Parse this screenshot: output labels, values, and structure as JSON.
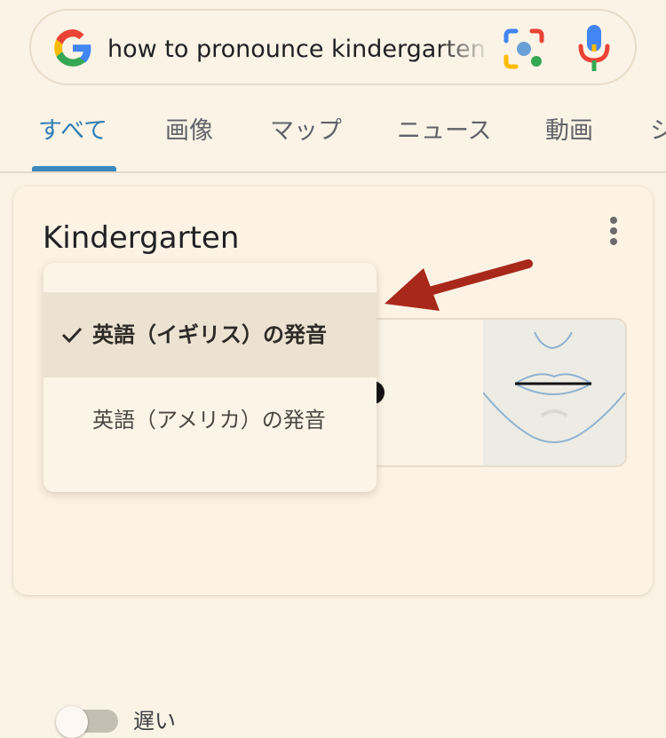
{
  "search": {
    "query": "how to pronounce kindergarten",
    "logo_icon": "google-g-icon",
    "lens_icon": "lens-icon",
    "mic_icon": "mic-icon"
  },
  "tabs": [
    {
      "label": "すべて",
      "active": true
    },
    {
      "label": "画像"
    },
    {
      "label": "マップ"
    },
    {
      "label": "ニュース"
    },
    {
      "label": "動画"
    },
    {
      "label": "シ"
    }
  ],
  "card": {
    "title": "Kindergarten",
    "more_icon": "more-vert-icon",
    "dropdown": {
      "options": [
        {
          "label": "英語（イギリス）の発音",
          "selected": true
        },
        {
          "label": "英語（アメリカ）の発音",
          "selected": false
        }
      ]
    },
    "speed_toggle": {
      "label": "遅い",
      "on": false
    }
  },
  "colors": {
    "background": "#fbf3e6",
    "accent_blue": "#3a89be",
    "annotation_arrow": "#a8291b"
  }
}
